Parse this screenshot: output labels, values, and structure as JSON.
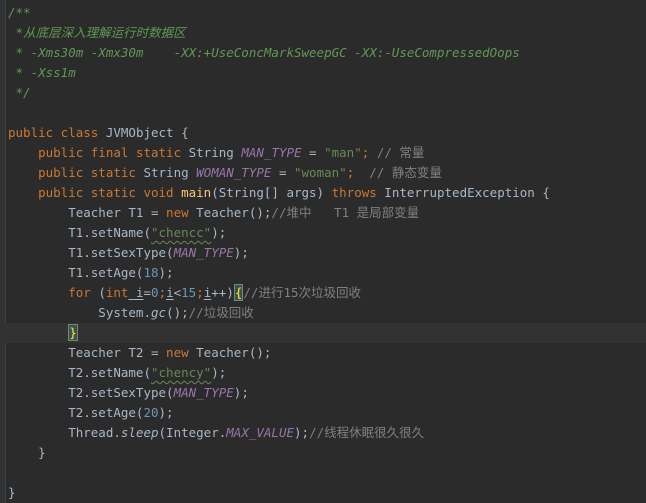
{
  "editor": {
    "file_language": "java",
    "lines": {
      "l1": "/**",
      "l2a": " *",
      "l2b": "从底层深入理解运行时数据区",
      "l3a": " * ",
      "l3b": "-Xms30m -Xmx30m    -XX:+UseConcMarkSweepGC -XX:-UseCompressedOops",
      "l4a": " * ",
      "l4b": "-Xss1m",
      "l5": " */",
      "l7a": "public class",
      "l7b": " JVMObject {",
      "l8a": "    public final static",
      "l8b": " String ",
      "l8c": "MAN_TYPE",
      "l8d": " = ",
      "l8e": "\"man\"",
      "l8f": "; ",
      "l8g": "// 常量",
      "l9a": "    public static",
      "l9b": " String ",
      "l9c": "WOMAN_TYPE",
      "l9d": " = ",
      "l9e": "\"woman\"",
      "l9f": ";  ",
      "l9g": "// 静态变量",
      "l10a": "    public static void ",
      "l10b": "main",
      "l10c": "(String[] args) ",
      "l10d": "throws",
      "l10e": " InterruptedException {",
      "l11a": "        Teacher T1 = ",
      "l11b": "new",
      "l11c": " Teacher();",
      "l11d": "//堆中   T1 是局部变量",
      "l12a": "        T1.setName(",
      "l12b": "\"chencc\"",
      "l12c": ");",
      "l13a": "        T1.setSexType(",
      "l13b": "MAN_TYPE",
      "l13c": ");",
      "l14a": "        T1.setAge(",
      "l14b": "18",
      "l14c": ");",
      "l15a": "        ",
      "l15b": "for",
      "l15c": " (",
      "l15d": "int",
      "l15e": " i",
      "l15f": "=",
      "l15g": "0",
      "l15h": ";",
      "l15i": "i",
      "l15j": "<",
      "l15k": "15",
      "l15l": ";",
      "l15m": "i",
      "l15n": "++)",
      "l15o": "{",
      "l15p": "//进行15次垃圾回收",
      "l16a": "            System.",
      "l16b": "gc",
      "l16c": "();",
      "l16d": "//垃圾回收",
      "l17a": "        ",
      "l17b": "}",
      "l18a": "        Teacher T2 = ",
      "l18b": "new",
      "l18c": " Teacher();",
      "l19a": "        T2.setName(",
      "l19b": "\"chency\"",
      "l19c": ");",
      "l20a": "        T2.setSexType(",
      "l20b": "MAN_TYPE",
      "l20c": ");",
      "l21a": "        T2.setAge(",
      "l21b": "20",
      "l21c": ");",
      "l22a": "        Thread.",
      "l22b": "sleep",
      "l22c": "(Integer.",
      "l22d": "MAX_VALUE",
      "l22e": ");",
      "l22f": "//线程休眠很久很久",
      "l23": "    }",
      "l25": "}"
    }
  },
  "colors": {
    "background": "#2b2b2b",
    "keyword": "#cc7832",
    "string": "#6a8759",
    "number": "#6897bb",
    "doc_comment": "#629755",
    "field": "#9876aa",
    "method": "#ffc66d",
    "text": "#a9b7c6"
  }
}
